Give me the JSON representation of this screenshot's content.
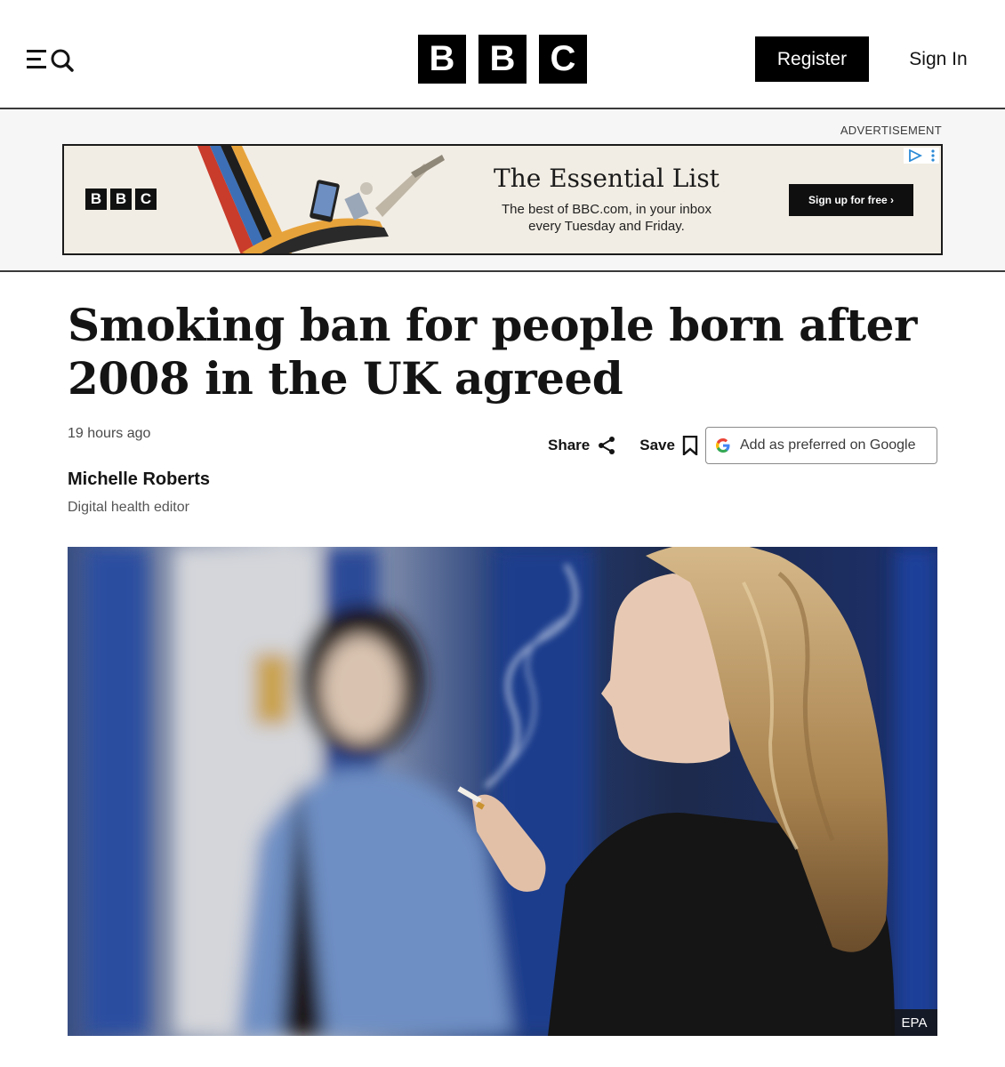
{
  "header": {
    "logo_letters": [
      "B",
      "B",
      "C"
    ],
    "register_label": "Register",
    "signin_label": "Sign In",
    "menu_icon": "menu-search-icon"
  },
  "ad": {
    "label": "ADVERTISEMENT",
    "logo_letters": [
      "B",
      "B",
      "C"
    ],
    "title": "The Essential List",
    "subtitle_line1": "The best of BBC.com, in your inbox",
    "subtitle_line2": "every Tuesday and Friday.",
    "cta_label": "Sign up for free ›",
    "choice_icon": "ad-choices-icon"
  },
  "article": {
    "headline": "Smoking ban for people born after 2008 in the UK agreed",
    "timestamp": "19 hours ago",
    "share_label": "Share",
    "save_label": "Save",
    "google_label": "Add as preferred on Google",
    "author": "Michelle Roberts",
    "author_role": "Digital health editor",
    "image_credit": "EPA"
  },
  "colors": {
    "brand_black": "#000000",
    "text": "#141414",
    "ad_background": "#f2ede4",
    "band_background": "#f6f6f6"
  }
}
